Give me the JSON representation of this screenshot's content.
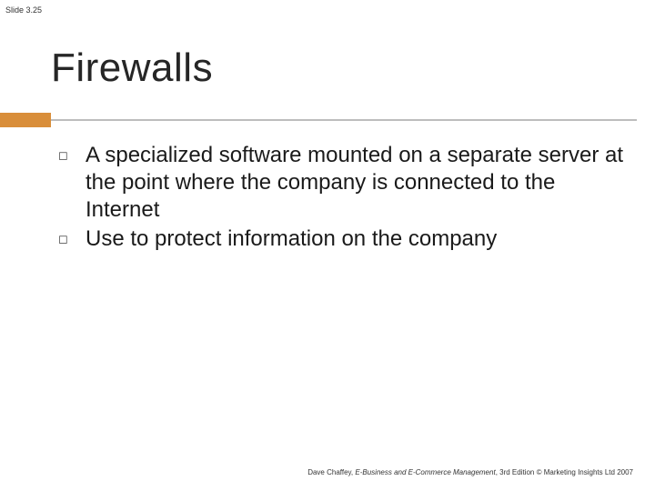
{
  "slide_number": "Slide 3.25",
  "title": "Firewalls",
  "bullets": [
    "A specialized software mounted on a separate server at the point where the company is connected to the Internet",
    "Use to protect information on the company"
  ],
  "bullet_mark": "◻",
  "footer": {
    "author": "Dave Chaffey, ",
    "book": "E-Business and E-Commerce Management",
    "rest": ", 3rd Edition © Marketing Insights Ltd 2007"
  }
}
